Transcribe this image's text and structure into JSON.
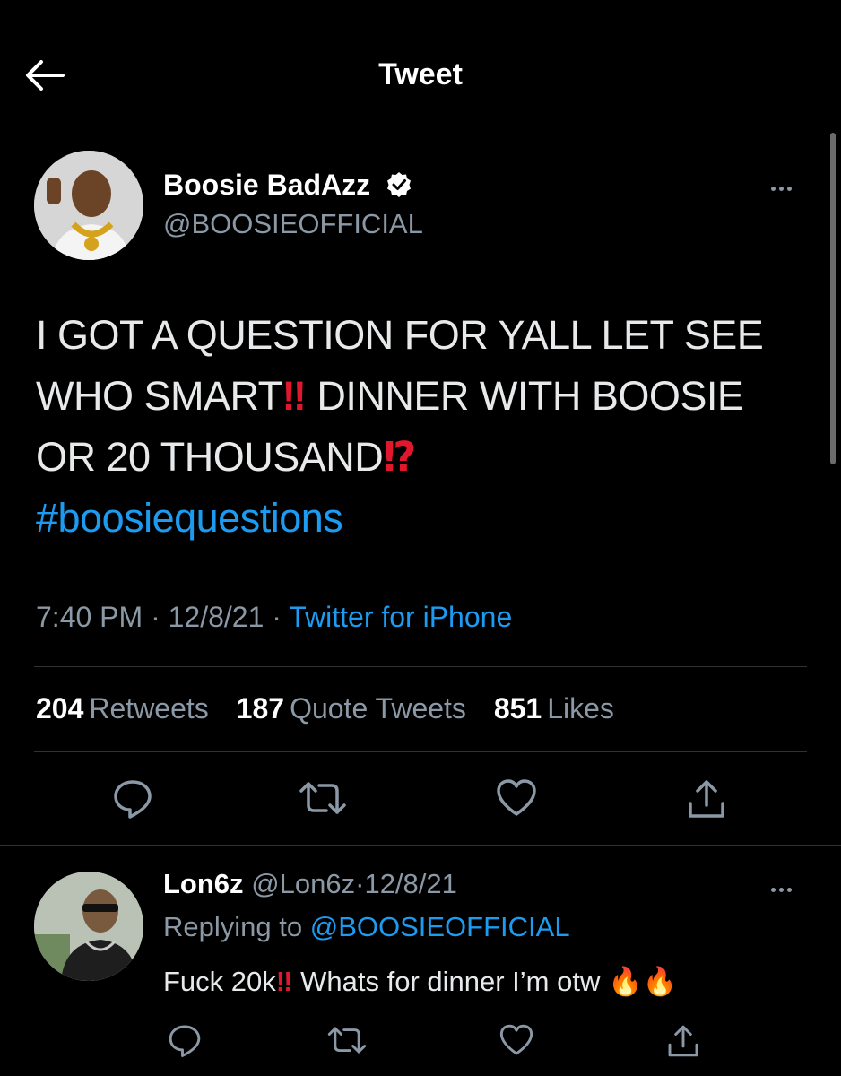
{
  "header": {
    "title": "Tweet",
    "back_icon": "arrow-left-icon"
  },
  "tweet": {
    "author_name": "Boosie BadAzz",
    "author_handle": "@BOOSIEOFFICIAL",
    "text_part1": "I GOT A QUESTION FOR YALL LET SEE WHO SMART",
    "text_bang1": "‼",
    "text_part2": " DINNER WITH BOOSIE OR 20 THOUSAND",
    "text_bang2": "⁉",
    "hashtag": "#boosiequestions",
    "time": "7:40 PM",
    "date": "12/8/21",
    "source": "Twitter for iPhone",
    "separator": "·",
    "retweets_count": "204",
    "retweets_label": "Retweets",
    "quotes_count": "187",
    "quotes_label": "Quote Tweets",
    "likes_count": "851",
    "likes_label": "Likes"
  },
  "reply": {
    "author_name": "Lon6z",
    "author_handle": "@Lon6z",
    "date": "12/8/21",
    "separator": "·",
    "replying_prefix": "Replying to",
    "replying_mention": "@BOOSIEOFFICIAL",
    "text_part1": "Fuck 20k",
    "text_bang": "‼",
    "text_part2": " Whats for dinner I’m otw ",
    "emoji": "🔥🔥"
  },
  "colors": {
    "accent": "#1d9bf0",
    "muted": "#8b98a5",
    "alert": "#e0172d",
    "background": "#000000"
  },
  "icons": [
    "reply-icon",
    "retweet-icon",
    "like-icon",
    "share-icon",
    "verified-badge-icon",
    "more-icon"
  ]
}
